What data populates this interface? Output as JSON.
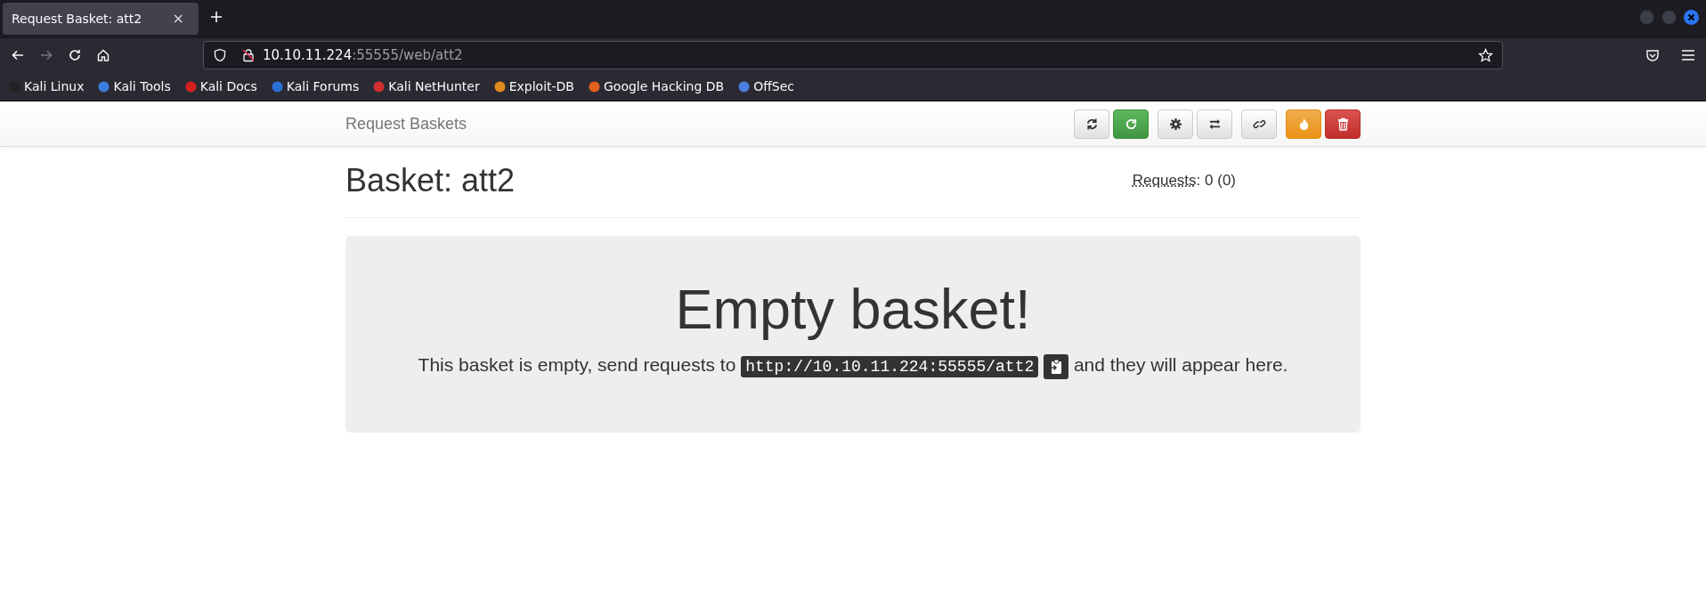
{
  "browser": {
    "tabs": [
      {
        "title": "Request Basket: att2",
        "close": "×",
        "selected": true
      }
    ],
    "address": {
      "host": "10.10.11.224",
      "path": ":55555/web/att2"
    },
    "bookmarks": [
      {
        "label": "Kali Linux",
        "color": "#222222"
      },
      {
        "label": "Kali Tools",
        "color": "#3b7ddd"
      },
      {
        "label": "Kali Docs",
        "color": "#d52020"
      },
      {
        "label": "Kali Forums",
        "color": "#2a6fd6"
      },
      {
        "label": "Kali NetHunter",
        "color": "#d23030"
      },
      {
        "label": "Exploit-DB",
        "color": "#e08a1e"
      },
      {
        "label": "Google Hacking DB",
        "color": "#e0601e"
      },
      {
        "label": "OffSec",
        "color": "#4a7fe0"
      }
    ]
  },
  "navbar": {
    "brand": "Request Baskets"
  },
  "basket": {
    "title": "Basket: att2",
    "requests_label": "Requests",
    "requests_count": ": 0 (0)"
  },
  "empty": {
    "heading": "Empty basket!",
    "text_before": "This basket is empty, send requests to",
    "url": "http://10.10.11.224:55555/att2",
    "text_after": "and they will appear here."
  }
}
